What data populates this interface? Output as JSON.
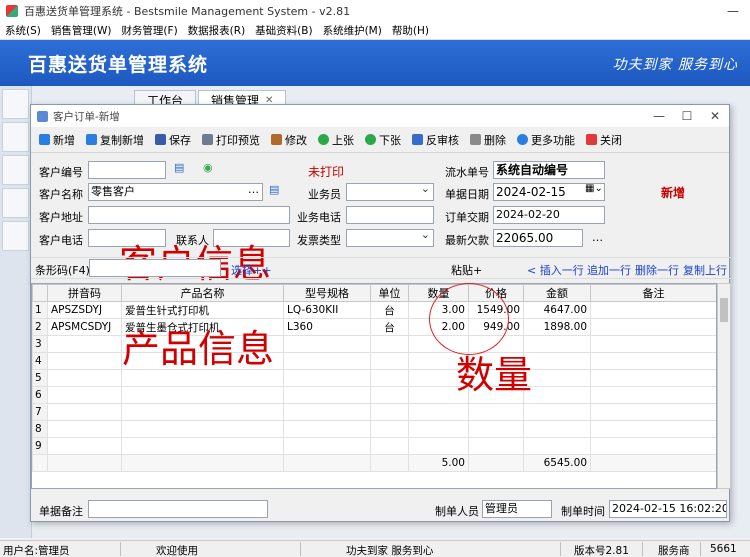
{
  "window": {
    "title": "百惠送货单管理系统 - Bestsmile Management System - v2.81"
  },
  "menu": [
    "系统(S)",
    "销售管理(W)",
    "财务管理(F)",
    "数据报表(R)",
    "基础资料(B)",
    "系统维护(M)",
    "帮助(H)"
  ],
  "banner": {
    "title": "百惠送货单管理系统",
    "slogan": "功夫到家  服务到心"
  },
  "tabs": [
    {
      "label": "工作台"
    },
    {
      "label": "销售管理"
    }
  ],
  "dialog": {
    "title": "客户订单-新增"
  },
  "toolbar": [
    {
      "label": "新增",
      "icon": "plus-icon",
      "color": "#2a7de1"
    },
    {
      "label": "复制新增",
      "icon": "copy-plus-icon",
      "color": "#2a7de1"
    },
    {
      "label": "保存",
      "icon": "save-icon",
      "color": "#3b5ba8"
    },
    {
      "label": "打印预览",
      "icon": "print-preview-icon",
      "color": "#6b7c93"
    },
    {
      "label": "修改",
      "icon": "edit-icon",
      "color": "#b06a2a"
    },
    {
      "label": "上张",
      "icon": "prev-icon",
      "color": "#2aa84a"
    },
    {
      "label": "下张",
      "icon": "next-icon",
      "color": "#2aa84a"
    },
    {
      "label": "反审核",
      "icon": "unaudit-icon",
      "color": "#3a6bc8"
    },
    {
      "label": "删除",
      "icon": "delete-icon",
      "color": "#8a8a8a"
    },
    {
      "label": "更多功能",
      "icon": "gear-icon",
      "color": "#2a7de1"
    },
    {
      "label": "关闭",
      "icon": "close-icon",
      "color": "#e03a3a"
    }
  ],
  "form": {
    "customer_code_label": "客户编号",
    "customer_name_label": "客户名称",
    "customer_name_value": "零售客户",
    "customer_addr_label": "客户地址",
    "customer_phone_label": "客户电话",
    "contact_label": "联系人",
    "print_status": "未打印",
    "salesman_label": "业务员",
    "sales_phone_label": "业务电话",
    "invoice_type_label": "发票类型",
    "serial_label": "流水单号",
    "serial_value": "系统自动编号",
    "doc_date_label": "单据日期",
    "doc_date_value": "2024-02-15",
    "delivery_date_label": "订单交期",
    "delivery_date_value": "2024-02-20",
    "debt_label": "最新欠款",
    "debt_value": "22065.00",
    "mode": "新增"
  },
  "annotations": {
    "customer_info": "客户信息",
    "product_info": "产品信息",
    "quantity": "数量"
  },
  "barcode": {
    "label": "条形码(F4)",
    "select_link": "选择++",
    "paste": "粘贴+",
    "insert_row": "< 插入一行",
    "append_row": "追加一行",
    "delete_row": "删除一行",
    "copy_up": "复制上行"
  },
  "grid": {
    "columns": [
      "",
      "拼音码",
      "产品名称",
      "型号规格",
      "单位",
      "数量",
      "价格",
      "金额",
      "备注"
    ],
    "rows": [
      [
        "1",
        "APSZSDYJ",
        "爱普生针式打印机",
        "LQ-630KII",
        "台",
        "3.00",
        "1549.00",
        "4647.00",
        ""
      ],
      [
        "2",
        "APSMCSDYJ",
        "爱普生墨仓式打印机",
        "L360",
        "台",
        "2.00",
        "949.00",
        "1898.00",
        ""
      ],
      [
        "3",
        "",
        "",
        "",
        "",
        "",
        "",
        "",
        ""
      ],
      [
        "4",
        "",
        "",
        "",
        "",
        "",
        "",
        "",
        ""
      ],
      [
        "5",
        "",
        "",
        "",
        "",
        "",
        "",
        "",
        ""
      ],
      [
        "6",
        "",
        "",
        "",
        "",
        "",
        "",
        "",
        ""
      ],
      [
        "7",
        "",
        "",
        "",
        "",
        "",
        "",
        "",
        ""
      ],
      [
        "8",
        "",
        "",
        "",
        "",
        "",
        "",
        "",
        ""
      ],
      [
        "9",
        "",
        "",
        "",
        "",
        "",
        "",
        "",
        ""
      ]
    ],
    "totals": {
      "quantity": "5.00",
      "amount": "6545.00"
    }
  },
  "footer": {
    "remark_label": "单据备注",
    "maker_label": "制单人员",
    "maker_value": "管理员",
    "make_time_label": "制单时间",
    "make_time_value": "2024-02-15 16:02:20"
  },
  "status": {
    "user": "用户名:管理员",
    "welcome": "欢迎使用",
    "slogan": "功夫到家  服务到心",
    "version": "版本号2.81",
    "service": "服务商",
    "phone_prefix": "5661"
  }
}
